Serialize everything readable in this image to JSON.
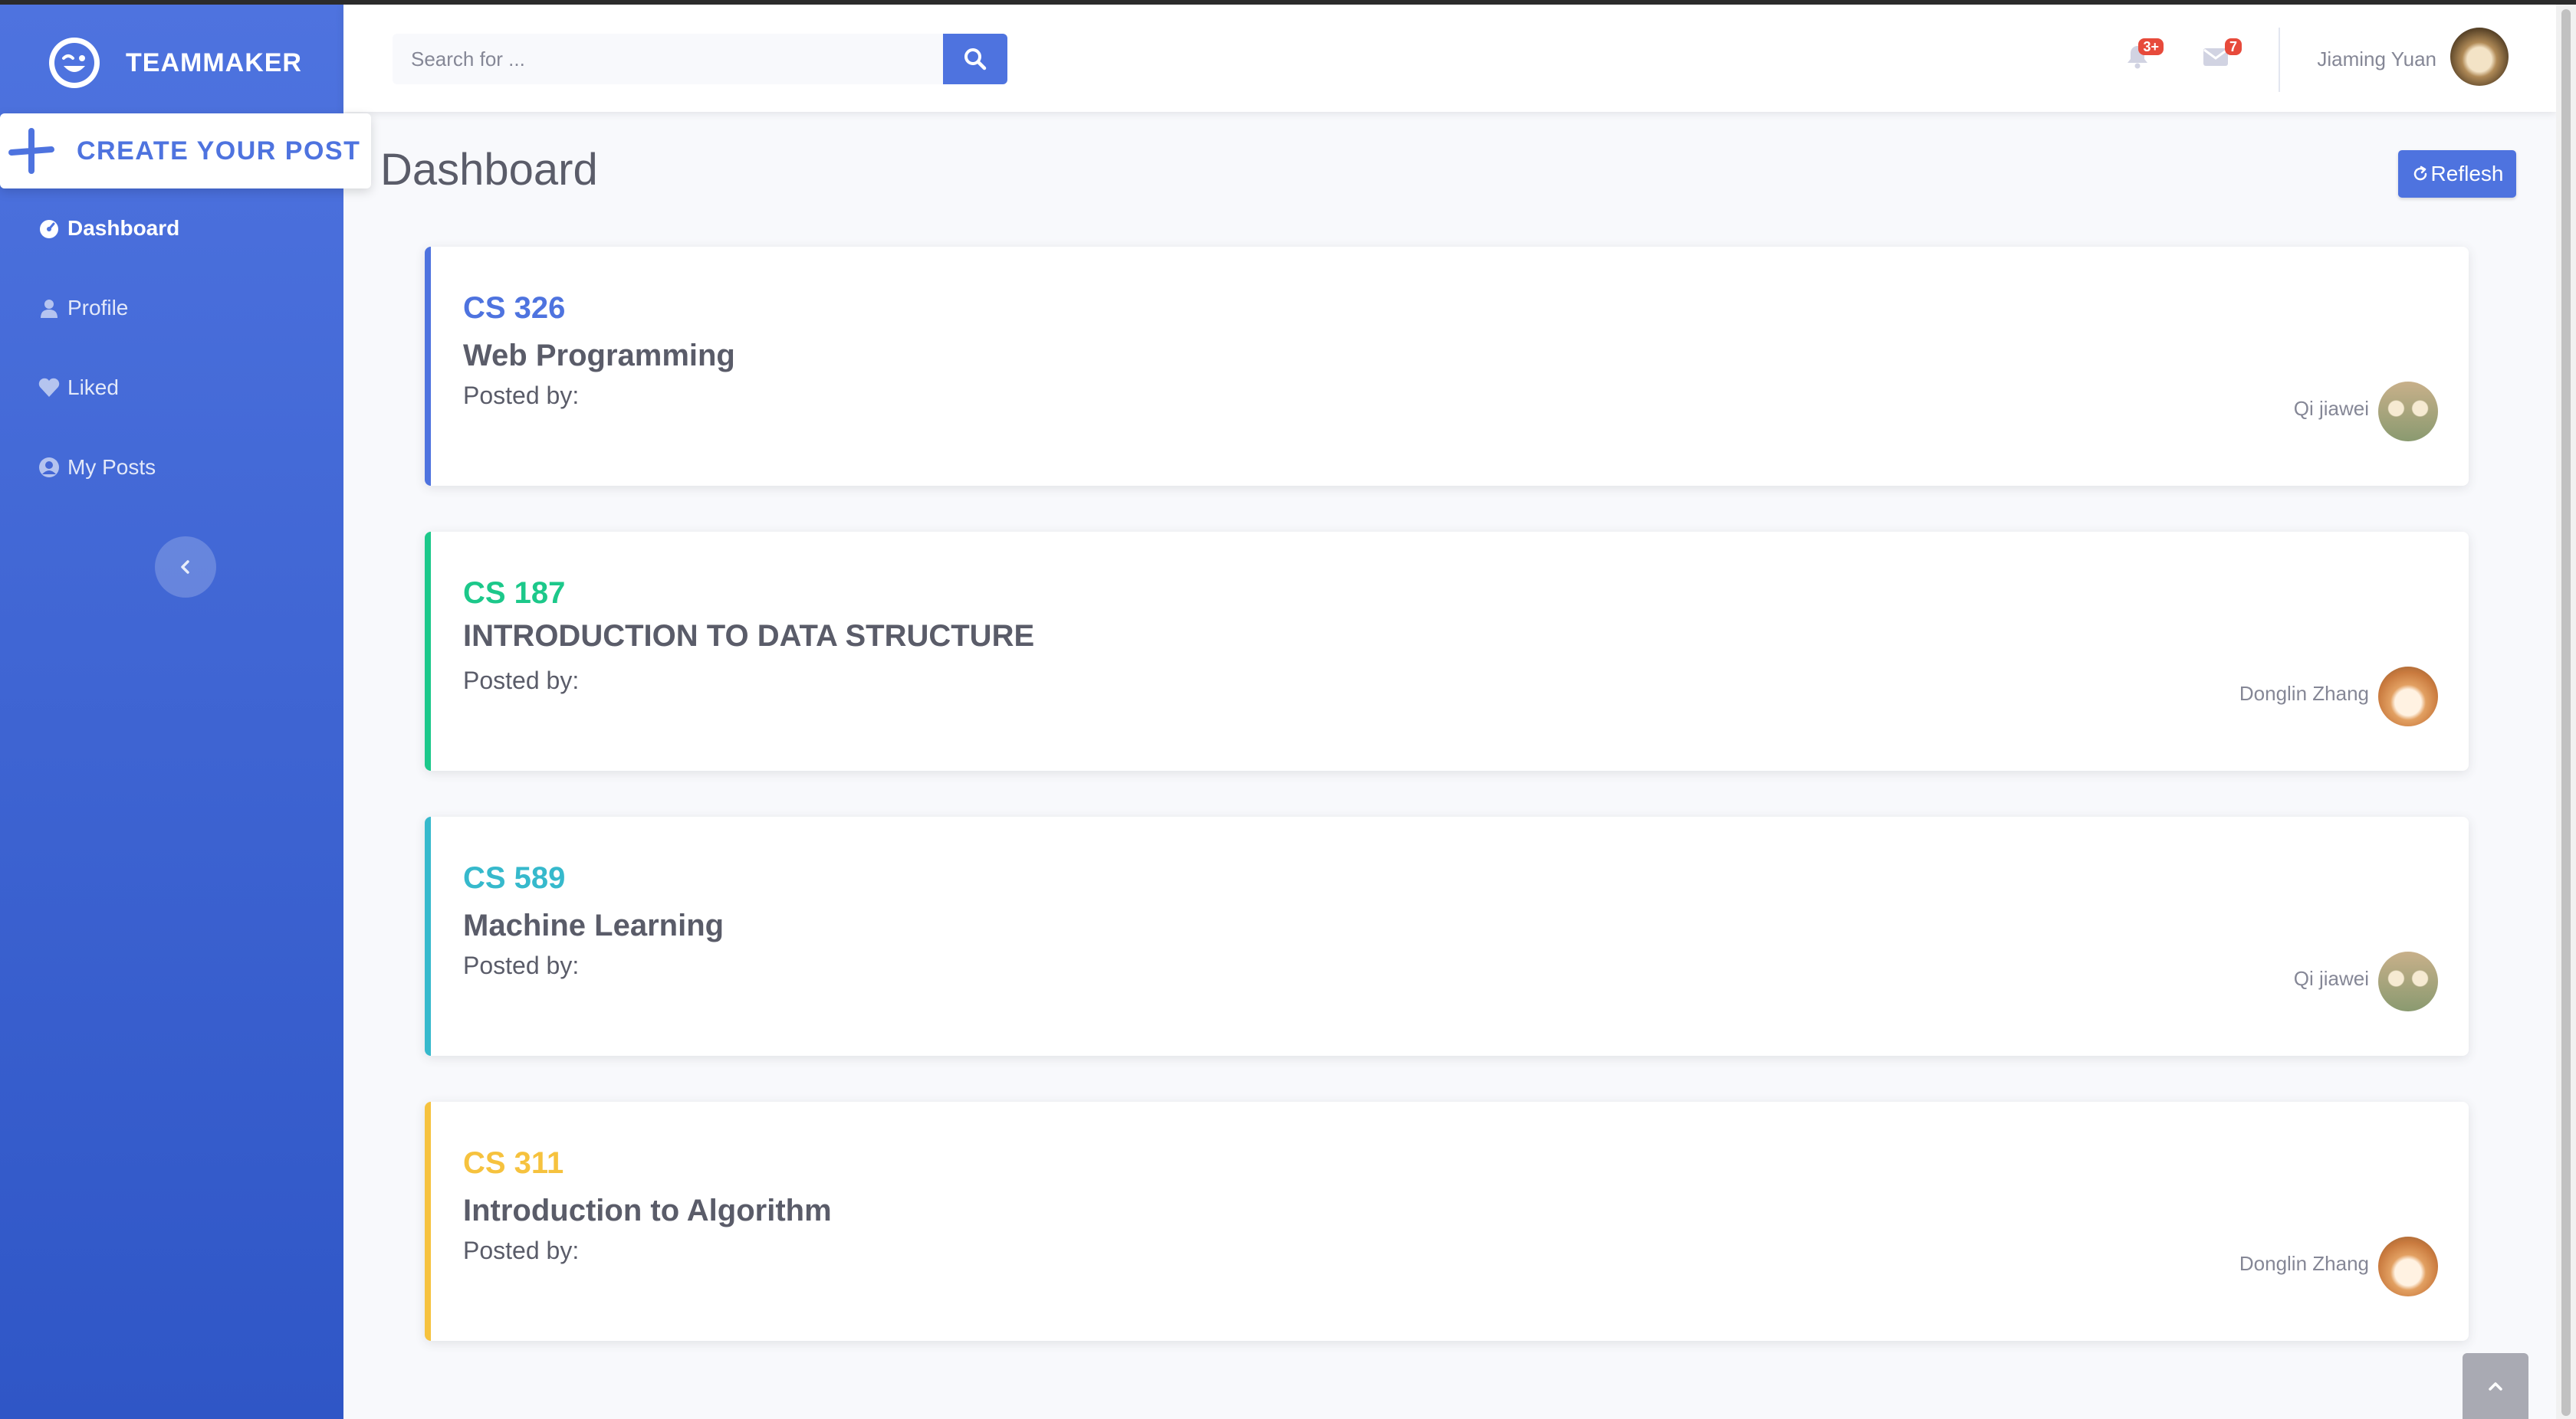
{
  "brand": {
    "name": "TEAMMAKER"
  },
  "create_post": {
    "label": "CREATE YOUR POST"
  },
  "sidebar": {
    "items": [
      {
        "label": "Dashboard",
        "icon": "tachometer-icon",
        "active": true
      },
      {
        "label": "Profile",
        "icon": "user-icon",
        "active": false
      },
      {
        "label": "Liked",
        "icon": "heart-icon",
        "active": false
      },
      {
        "label": "My Posts",
        "icon": "user-circle-icon",
        "active": false
      }
    ]
  },
  "topbar": {
    "search_placeholder": "Search for ...",
    "alerts_badge": "3+",
    "messages_badge": "7",
    "user_name": "Jiaming Yuan"
  },
  "main": {
    "title": "Dashboard",
    "refresh_label": "Reflesh"
  },
  "posts": [
    {
      "code": "CS 326",
      "title": "Web Programming",
      "posted_by_label": "Posted by:",
      "author": "Qi jiawei",
      "color": "#4e73df",
      "avatar": "dogs"
    },
    {
      "code": "CS 187",
      "title": "INTRODUCTION TO DATA STRUCTURE",
      "posted_by_label": "Posted by:",
      "author": "Donglin Zhang",
      "color": "#1cc88a",
      "avatar": "shiba"
    },
    {
      "code": "CS 589",
      "title": "Machine Learning",
      "posted_by_label": "Posted by:",
      "author": "Qi jiawei",
      "color": "#36b9cc",
      "avatar": "dogs"
    },
    {
      "code": "CS 311",
      "title": "Introduction to Algorithm",
      "posted_by_label": "Posted by:",
      "author": "Donglin Zhang",
      "color": "#f6c23e",
      "avatar": "shiba"
    }
  ]
}
